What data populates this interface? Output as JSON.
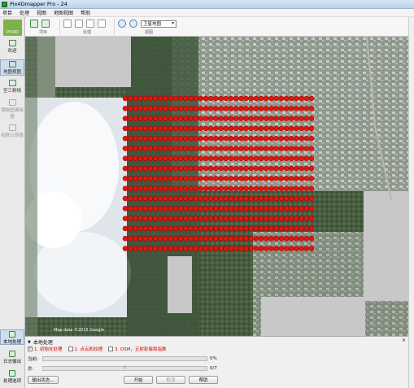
{
  "window": {
    "title": "Pix4Dmapper Pro - 24"
  },
  "menu": [
    {
      "label": "项目"
    },
    {
      "label": "处理"
    },
    {
      "label": "视图"
    },
    {
      "label": "地图视图"
    },
    {
      "label": "帮助"
    }
  ],
  "toolbar": {
    "groups": [
      {
        "label": "项目"
      },
      {
        "label": "处理"
      },
      {
        "label": "视图"
      }
    ],
    "map_type": "卫星地图"
  },
  "sidebar": {
    "logo": "PIX4D",
    "items": [
      {
        "label": "欢迎"
      },
      {
        "label": "地图视图"
      },
      {
        "label": "空三射线"
      },
      {
        "label": "镶嵌图编辑器"
      },
      {
        "label": "指数计算器"
      }
    ],
    "bottom_items": [
      {
        "label": "本地处理"
      },
      {
        "label": "日志输出"
      },
      {
        "label": "处理选项"
      }
    ]
  },
  "map": {
    "attribution": "Map data ©2015 Google",
    "colors": {
      "camera_point": "#e8140c",
      "camera_outline": "#7a0000",
      "flight_line": "#22cc22"
    }
  },
  "processing_panel": {
    "title": "本地处理",
    "close": "×",
    "steps": [
      {
        "label": "1. 初始化处理",
        "checked": true
      },
      {
        "label": "2. 点云和纹理",
        "checked": false
      },
      {
        "label": "3. DSM，正射影像和指数",
        "checked": false
      }
    ],
    "current": {
      "label": "当前:",
      "value": "0%",
      "progress": 0.0
    },
    "total": {
      "label": "总:",
      "value": "0/7",
      "progress": 0.0,
      "marker": "1."
    },
    "buttons": {
      "log": "输出状态...",
      "start": "开始",
      "cancel": "取消",
      "help": "帮助"
    }
  }
}
